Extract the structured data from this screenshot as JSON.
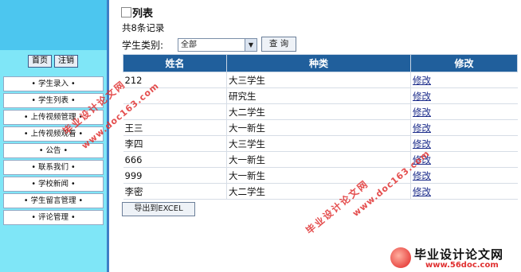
{
  "sidebar": {
    "home_label": "首页",
    "logout_label": "注销",
    "items": [
      "• 学生录入 •",
      "• 学生列表 •",
      "• 上传视频管理 •",
      "• 上传视频观看 •",
      "• 公告 •",
      "• 联系我们 •",
      "• 学校新闻 •",
      "• 学生留言管理 •",
      "• 评论管理 •"
    ]
  },
  "main": {
    "title": "列表",
    "count_text": "共8条记录",
    "filter_label": "学生类别:",
    "filter_value": "全部",
    "query_label": "查 询",
    "export_label": "导出到EXCEL",
    "table": {
      "headers": [
        "姓名",
        "种类",
        "修改"
      ],
      "rows": [
        {
          "name": "212",
          "type": "大三学生",
          "action": "修改"
        },
        {
          "name": "",
          "type": "研究生",
          "action": "修改"
        },
        {
          "name": "",
          "type": "大二学生",
          "action": "修改"
        },
        {
          "name": "王三",
          "type": "大一新生",
          "action": "修改"
        },
        {
          "name": "李四",
          "type": "大三学生",
          "action": "修改"
        },
        {
          "name": "666",
          "type": "大一新生",
          "action": "修改"
        },
        {
          "name": "999",
          "type": "大一新生",
          "action": "修改"
        },
        {
          "name": "李密",
          "type": "大二学生",
          "action": "修改"
        }
      ]
    }
  },
  "watermark": {
    "line1": "毕业设计论文网",
    "line2": "www.doc163.com",
    "logo_text": "毕业设计论文网",
    "logo_url": "www.56doc.com"
  },
  "colors": {
    "header_bg": "#205f9c",
    "sidebar_bg": "#7fe6f7",
    "sidebar_top": "#4cc6ef",
    "divider": "#3f7ec6",
    "watermark": "#e03030"
  }
}
